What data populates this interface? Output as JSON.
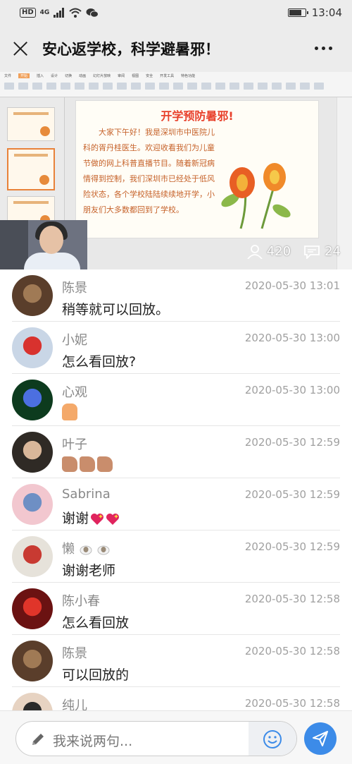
{
  "status_bar": {
    "hd_badge": "HD",
    "network": "4G",
    "time": "13:04"
  },
  "titlebar": {
    "title": "安心返学校，科学避暑邪！"
  },
  "video": {
    "slide_title": "开学预防暑邪!",
    "slide_text": "大家下午好！我是深圳市中医院儿科的胥丹桂医生。欢迎收看我们为儿童节做的网上科普直播节目。随着新冠病情得到控制，我们深圳市已经处于低风险状态，各个学校陆陆续续地开学，小朋友们大多数都回到了学校。",
    "viewers": "420",
    "comments_count": "24"
  },
  "comments": [
    {
      "name": "陈景",
      "time": "2020-05-30 13:01",
      "text": "稍等就可以回放。",
      "avatar_color": "#5a3e2b",
      "avatar_accent": "#a07a55"
    },
    {
      "name": "小妮",
      "time": "2020-05-30 13:00",
      "text": "怎么看回放?",
      "avatar_color": "#c9d6e6",
      "avatar_accent": "#d8322e"
    },
    {
      "name": "心观",
      "time": "2020-05-30 13:00",
      "text": "",
      "emoji": "folded-hands",
      "avatar_color": "#0d3b1e",
      "avatar_accent": "#4c6fe0"
    },
    {
      "name": "叶子",
      "time": "2020-05-30 12:59",
      "text": "",
      "emoji": "thumbs-up-x3",
      "avatar_color": "#2f2a25",
      "avatar_accent": "#d9b79a"
    },
    {
      "name": "Sabrina",
      "time": "2020-05-30 12:59",
      "text": "谢谢",
      "emoji": "sparkling-heart-x2",
      "avatar_color": "#f2c7cf",
      "avatar_accent": "#6e8fc4"
    },
    {
      "name": "懒",
      "name_emoji": "sheep-x2",
      "time": "2020-05-30 12:59",
      "text": "谢谢老师",
      "avatar_color": "#e6e2da",
      "avatar_accent": "#c83a32"
    },
    {
      "name": "陈小春",
      "time": "2020-05-30 12:58",
      "text": "怎么看回放",
      "avatar_color": "#6b1212",
      "avatar_accent": "#e0352a"
    },
    {
      "name": "陈景",
      "time": "2020-05-30 12:58",
      "text": "可以回放的",
      "avatar_color": "#5a3e2b",
      "avatar_accent": "#a07a55"
    },
    {
      "name": "纯儿",
      "time": "2020-05-30 12:58",
      "text": "",
      "avatar_color": "#e7d3c2",
      "avatar_accent": "#2a2a2a"
    }
  ],
  "input": {
    "placeholder": "我来说两句..."
  },
  "colors": {
    "accent": "#3c8be8",
    "slide_title": "#e8402b"
  }
}
